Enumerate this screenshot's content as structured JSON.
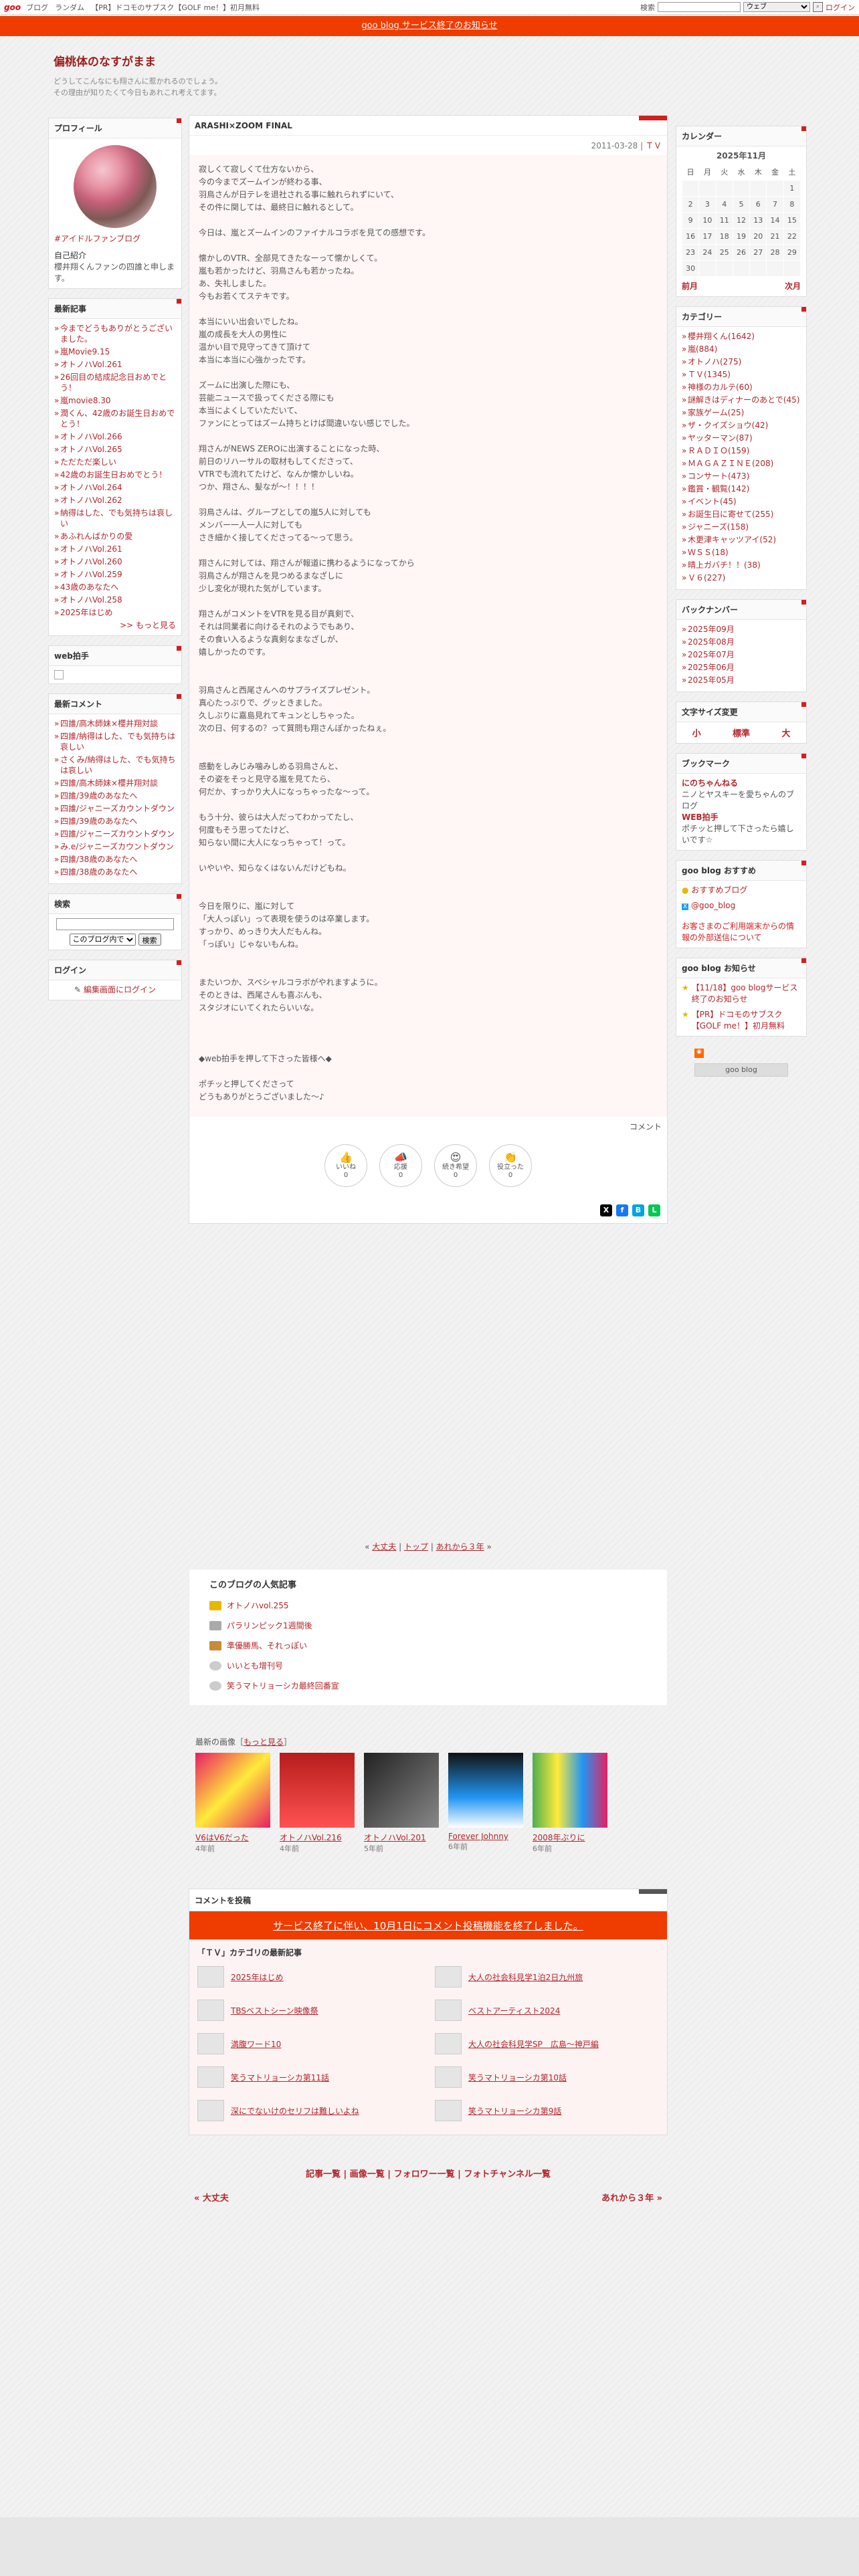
{
  "topbar": {
    "logo": "goo",
    "links": [
      "ブログ",
      "ランダム",
      "【PR】ドコモのサブスク【GOLF me！】初月無料"
    ],
    "search_label": "検索",
    "search_value": "",
    "select_value": "ウェブ",
    "login": "ログイン"
  },
  "notice": "goo blog サービス終了のお知らせ",
  "blog": {
    "title": "偏桃体のなすがまま",
    "desc1": "どうしてこんなにも翔さんに惹かれるのでしょう。",
    "desc2": "その理由が知りたくて今日もあれこれ考えてます。"
  },
  "profile": {
    "title": "プロフィール",
    "name": "#アイドルファンブログ",
    "intro_label": "自己紹介",
    "intro": "櫻井翔くんファンの四誰と申します。"
  },
  "recent": {
    "title": "最新記事",
    "items": [
      "今までどうもありがとうございました。",
      "嵐Movie9.15",
      "オトノハVol.261",
      "26回目の結成記念日おめでとう！",
      "嵐movie8.30",
      "潤くん、42歳のお誕生日おめでとう！",
      "オトノハVol.266",
      "オトノハVol.265",
      "ただただ楽しい",
      "42歳のお誕生日おめでとう！",
      "オトノハVol.264",
      "オトノハVol.262",
      "納得はした、でも気持ちは哀しい",
      "あふれんばかりの愛",
      "オトノハVol.261",
      "オトノハVol.260",
      "オトノハVol.259",
      "43歳のあなたへ",
      "オトノハVol.258",
      "2025年はじめ"
    ],
    "more": ">> もっと見る"
  },
  "webclap": {
    "title": "web拍手"
  },
  "recent_comments": {
    "title": "最新コメント",
    "items": [
      "四誰/高木師妹×櫻井翔対談",
      "四誰/納得はした、でも気持ちは哀しい",
      "さくみ/納得はした、でも気持ちは哀しい",
      "四誰/高木師妹×櫻井翔対談",
      "四誰/39歳のあなたへ",
      "四誰/ジャニーズカウントダウン",
      "四誰/39歳のあなたへ",
      "四誰/ジャニーズカウントダウン",
      "み.e/ジャニーズカウントダウン",
      "四誰/38歳のあなたへ",
      "四誰/38歳のあなたへ"
    ]
  },
  "search": {
    "title": "検索",
    "select": "このブログ内で",
    "button": "検索"
  },
  "login": {
    "title": "ログイン",
    "link": "編集画面にログイン"
  },
  "article": {
    "title": "ARASHI×ZOOM FINAL",
    "date": "2011-03-28",
    "cat": "ＴＶ",
    "body": "寂しくて寂しくて仕方ないから、\n今の今までズームインが終わる事、\n羽鳥さんが日テレを退社される事に触れられずにいて、\nその件に関しては、最終日に触れるとして。\n\n今日は、嵐とズームインのファイナルコラボを見ての感想です。\n\n懐かしのVTR、全部見てきたなーって懐かしくて。\n嵐も若かったけど、羽鳥さんも若かったね。\nあ、失礼しました。\n今もお若くてステキです。\n\n本当にいい出会いでしたね。\n嵐の成長を大人の男性に\n温かい目で見守ってきて頂けて\n本当に本当に心強かったです。\n\nズームに出演した際にも、\n芸能ニュースで扱ってくださる際にも\n本当によくしていただいて、\nファンにとってはズーム持ちとけば間違いない感じでした。\n\n翔さんがNEWS ZEROに出演することになった時、\n前日のリハーサルの取材もしてくださって、\nVTRでも流れてたけど、なんか懐かしいね。\nつか、翔さん、髪なが～！！！！\n\n羽鳥さんは、グループとしての嵐5人に対しても\nメンバー一人一人に対しても\nさき細かく接してくださってる～って思う。\n\n翔さんに対しては、翔さんが報道に携わるようになってから\n羽鳥さんが翔さんを見つめるまなざしに\n少し変化が現れた気がしています。\n\n翔さんがコメントをVTRを見る目が真剣で、\nそれは同業者に向けるそれのようでもあり、\nその食い入るような真剣なまなざしが、\n嬉しかったのです。\n\n\n羽鳥さんと西尾さんへのサプライズプレゼント。\n真心たっぷりで、グッときました。\n久しぶりに嘉島見れてキュンとしちゃった。\n次の日、何するの？って質問も翔さんぽかったねぇ。\n\n\n感動をしみじみ噛みしめる羽鳥さんと、\nその姿をそっと見守る嵐を見てたら、\n何だか、すっかり大人になっちゃったな～って。\n\nもう十分、彼らは大人だってわかってたし、\n何度もそう思ってたけど、\n知らない間に大人になっちゃって！って。\n\nいやいや、知らなくはないんだけどもね。\n\n\n今日を限りに、嵐に対して\n「大人っぽい」って表現を使うのは卒業します。\nすっかり、めっきり大人だもんね。\n「っぽい」じゃないもんね。\n\n\nまたいつか、スペシャルコラボがやれますように。\nそのときは、西尾さんも喜ぶんも、\nスタジオにいてくれたらいいな。\n\n\n\n◆web拍手を押して下さった皆様へ◆\n\nポチッと押してくださって\nどうもありがとうございました～♪",
    "comment_link": "コメント"
  },
  "reactions": [
    {
      "label": "いいね",
      "count": "0"
    },
    {
      "label": "応援",
      "count": "0"
    },
    {
      "label": "続き希望",
      "count": "0"
    },
    {
      "label": "役立った",
      "count": "0"
    }
  ],
  "calendar": {
    "title": "カレンダー",
    "month": "2025年11月",
    "days": [
      "日",
      "月",
      "火",
      "水",
      "木",
      "金",
      "土"
    ],
    "weeks": [
      [
        "",
        "",
        "",
        "",
        "",
        "",
        "1"
      ],
      [
        "2",
        "3",
        "4",
        "5",
        "6",
        "7",
        "8"
      ],
      [
        "9",
        "10",
        "11",
        "12",
        "13",
        "14",
        "15"
      ],
      [
        "16",
        "17",
        "18",
        "19",
        "20",
        "21",
        "22"
      ],
      [
        "23",
        "24",
        "25",
        "26",
        "27",
        "28",
        "29"
      ],
      [
        "30",
        "",
        "",
        "",
        "",
        "",
        ""
      ]
    ],
    "prev": "前月",
    "next": "次月"
  },
  "categories": {
    "title": "カテゴリー",
    "items": [
      "櫻井翔くん(1642)",
      "嵐(884)",
      "オトノハ(275)",
      "ＴＶ(1345)",
      "神様のカルテ(60)",
      "謎解きはディナーのあとで(45)",
      "家族ゲーム(25)",
      "ザ・クイズショウ(42)",
      "ヤッターマン(87)",
      "ＲＡＤＩＯ(159)",
      "ＭＡＧＡＺＩＮＥ(208)",
      "コンサート(473)",
      "鑑賞・観覧(142)",
      "イベント(45)",
      "お誕生日に寄せて(255)",
      "ジャニーズ(158)",
      "木更津キャッツアイ(52)",
      "ＷＳＳ(18)",
      "晴上ガバチ！！(38)",
      "Ｖ６(227)"
    ]
  },
  "backnumber": {
    "title": "バックナンバー",
    "items": [
      "2025年09月",
      "2025年08月",
      "2025年07月",
      "2025年06月",
      "2025年05月"
    ]
  },
  "fontsize": {
    "title": "文字サイズ変更",
    "small": "小",
    "normal": "標準",
    "large": "大"
  },
  "bookmark": {
    "title": "ブックマーク",
    "n1": "にのちゃんねる",
    "d1": "ニノとヤスキーを愛ちゃんのブログ",
    "n2": "WEB拍手",
    "d2": "ポチッと押して下さったら嬉しいです☆"
  },
  "goo_recommend": {
    "title": "goo blog おすすめ",
    "item1": "おすすめブログ",
    "item2": "@goo_blog",
    "warn": "お客さまのご利用端末からの情報の外部送信について"
  },
  "goo_notice": {
    "title": "goo blog お知らせ",
    "item1": "【11/18】goo blogサービス終了のお知らせ",
    "item2": "【PR】ドコモのサブスク【GOLF me！】初月無料",
    "badge": "goo blog"
  },
  "pager": {
    "prev": "大丈夫",
    "top": "トップ",
    "next": "あれから３年"
  },
  "popular": {
    "title": "このブログの人気記事",
    "items": [
      "オトノハvol.255",
      "パラリンピック1週間後",
      "準優勝馬、それっぽい",
      "いいとも增刊号",
      "笑うマトリョーシカ最終回番宣"
    ]
  },
  "images": {
    "title": "最新の画像",
    "more": "もっと見る",
    "items": [
      {
        "cap": "V6はV6だった",
        "ago": "4年前"
      },
      {
        "cap": "オトノハVol.216",
        "ago": "4年前"
      },
      {
        "cap": "オトノハVol.201",
        "ago": "5年前"
      },
      {
        "cap": "Forever Johnny",
        "ago": "6年前"
      },
      {
        "cap": "2008年ぶりに",
        "ago": "6年前"
      }
    ]
  },
  "comment_post": {
    "title": "コメントを投稿",
    "closed": "サービス終了に伴い、10月1日にコメント投稿機能を終了しました。"
  },
  "related": {
    "title": "「ＴＶ」カテゴリの最新記事",
    "items": [
      "2025年はじめ",
      "大人の社会科見学1泊2日九州旅",
      "TBSベストシーン映像祭",
      "ベストアーティスト2024",
      "満腹ワード10",
      "大人の社会科見学SP　広島〜神戸編",
      "笑うマトリョーシカ第11話",
      "笑うマトリョーシカ第10話",
      "深にでないけのセリフは難しいよね",
      "笑うマトリョーシカ第9話"
    ]
  },
  "footnav": [
    "記事一覧",
    "画像一覧",
    "フォロワー一覧",
    "フォトチャンネル一覧"
  ],
  "footnav2": {
    "prev": "« 大丈夫",
    "next": "あれから３年 »"
  }
}
